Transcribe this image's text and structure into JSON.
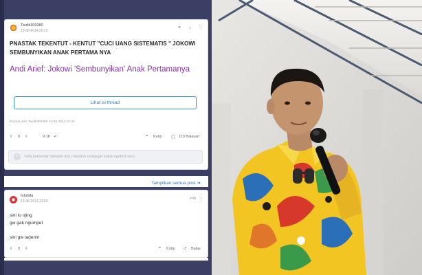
{
  "thread": {
    "username": "Taufik300380",
    "timestamp": "13-06-2014 20:22",
    "title": "PNASTAK TEKENTUT - KENTUT \"CUCI UANG SISTEMATIS \" JOKOWI SEMBUNYIKAN ANAK PERTAMA NYA",
    "link_text": "Andi Arief: Jokowi 'Sembunyikan' Anak Pertamanya",
    "view_button": "Lihat isi thread",
    "edited_note": "Diubah oleh Taufik300380 13-06-2014 22:40",
    "upvotes": "0",
    "downvotes": "9.1K",
    "quote_label": "Kutip",
    "replies_label": "110 Balasan",
    "comment_placeholder": "Tulis komentar menarik atau mention replykgpt untuk ngobrol seru"
  },
  "show_all": "Tampilkan semua post",
  "reply": {
    "username": "fufufafa",
    "timestamp": "13-06-2014 22:50",
    "number": "#48",
    "lines": [
      "sini lo njing",
      "gw gak ngumpet",
      "sini gw ladenin"
    ],
    "votes": "0",
    "quote_label": "Kutip",
    "reply_label": "Balas"
  },
  "colors": {
    "panel_bg": "#3a3f63",
    "link_purple": "#8a2fae",
    "button_blue": "#2f78c4",
    "shirt_yellow": "#f2c523"
  },
  "icons": [
    "link-icon",
    "bell-icon",
    "more-icon",
    "upvote-icon",
    "downvote-icon",
    "share-icon",
    "quote-icon",
    "comment-icon",
    "reply-icon",
    "chevron-right-icon"
  ]
}
